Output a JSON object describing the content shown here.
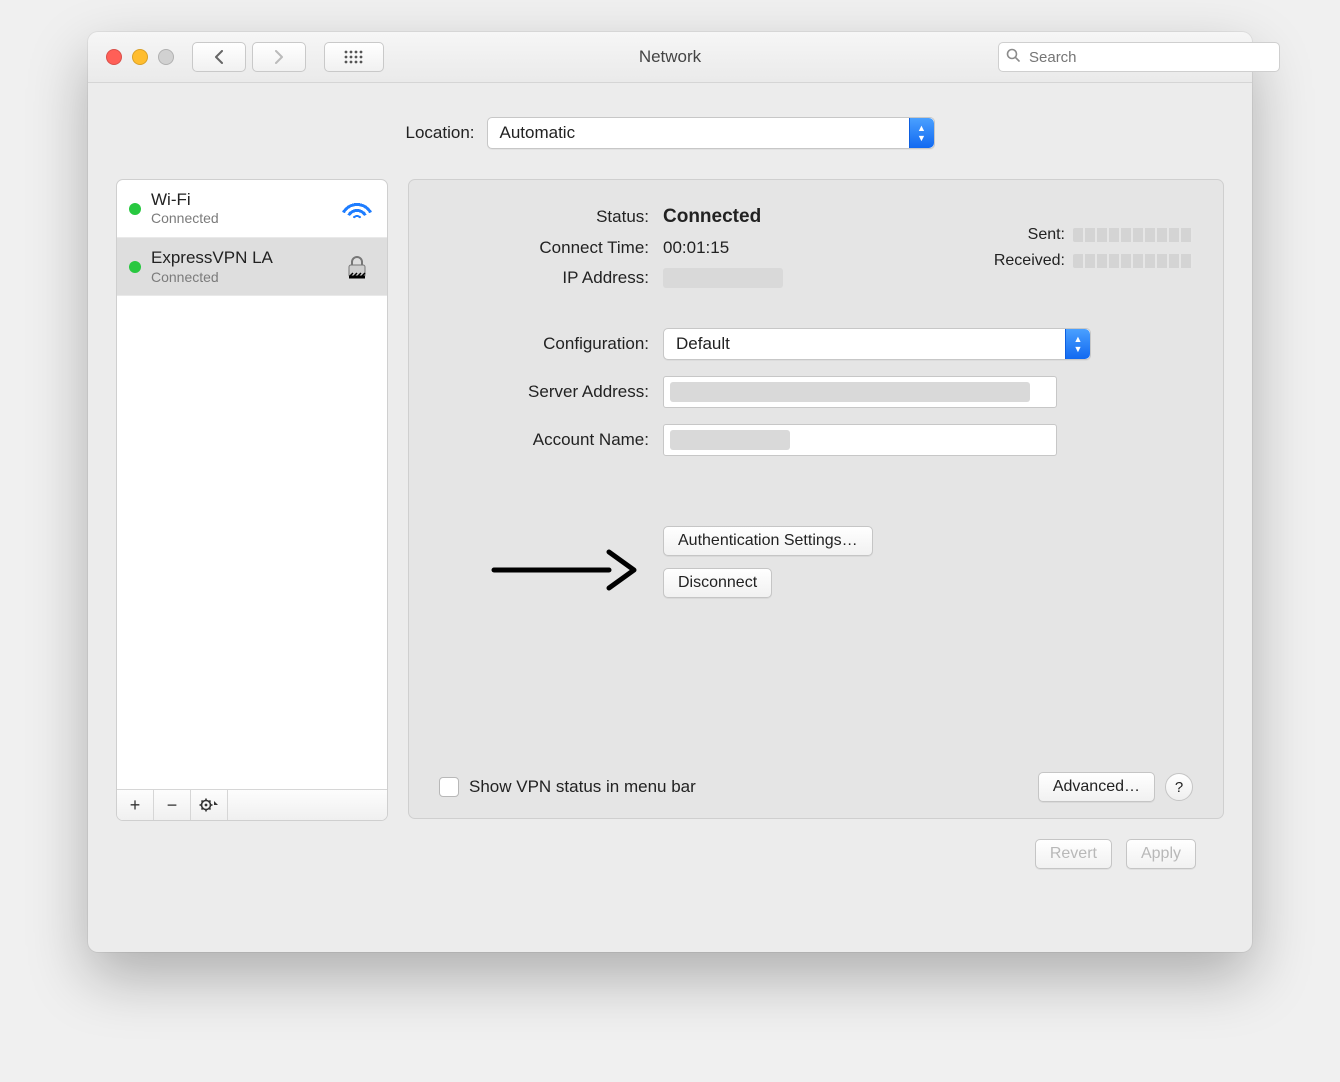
{
  "window": {
    "title": "Network",
    "search_placeholder": "Search"
  },
  "location": {
    "label": "Location:",
    "value": "Automatic"
  },
  "sidebar": {
    "items": [
      {
        "name": "Wi-Fi",
        "status": "Connected",
        "dot": "green",
        "icon": "wifi"
      },
      {
        "name": "ExpressVPN LA",
        "status": "Connected",
        "dot": "green",
        "icon": "lock"
      }
    ],
    "selected_index": 1
  },
  "details": {
    "status_label": "Status:",
    "status_value": "Connected",
    "connect_time_label": "Connect Time:",
    "connect_time_value": "00:01:15",
    "ip_label": "IP Address:",
    "sent_label": "Sent:",
    "received_label": "Received:",
    "configuration_label": "Configuration:",
    "configuration_value": "Default",
    "server_address_label": "Server Address:",
    "account_name_label": "Account Name:",
    "auth_settings_label": "Authentication Settings…",
    "disconnect_label": "Disconnect",
    "show_vpn_label": "Show VPN status in menu bar",
    "advanced_label": "Advanced…"
  },
  "footer": {
    "revert_label": "Revert",
    "apply_label": "Apply"
  }
}
